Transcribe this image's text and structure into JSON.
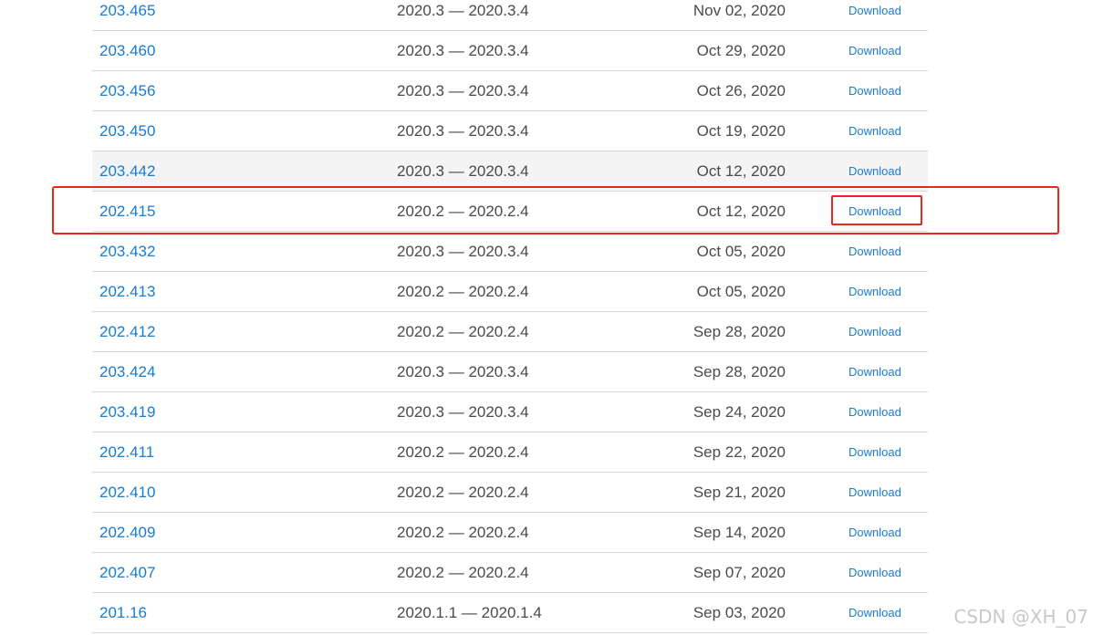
{
  "rows": [
    {
      "build": "203.465",
      "compat": "2020.3 — 2020.3.4",
      "date": "Nov 02, 2020",
      "action": "Download"
    },
    {
      "build": "203.460",
      "compat": "2020.3 — 2020.3.4",
      "date": "Oct 29, 2020",
      "action": "Download"
    },
    {
      "build": "203.456",
      "compat": "2020.3 — 2020.3.4",
      "date": "Oct 26, 2020",
      "action": "Download"
    },
    {
      "build": "203.450",
      "compat": "2020.3 — 2020.3.4",
      "date": "Oct 19, 2020",
      "action": "Download"
    },
    {
      "build": "203.442",
      "compat": "2020.3 — 2020.3.4",
      "date": "Oct 12, 2020",
      "action": "Download"
    },
    {
      "build": "202.415",
      "compat": "2020.2 — 2020.2.4",
      "date": "Oct 12, 2020",
      "action": "Download"
    },
    {
      "build": "203.432",
      "compat": "2020.3 — 2020.3.4",
      "date": "Oct 05, 2020",
      "action": "Download"
    },
    {
      "build": "202.413",
      "compat": "2020.2 — 2020.2.4",
      "date": "Oct 05, 2020",
      "action": "Download"
    },
    {
      "build": "202.412",
      "compat": "2020.2 — 2020.2.4",
      "date": "Sep 28, 2020",
      "action": "Download"
    },
    {
      "build": "203.424",
      "compat": "2020.3 — 2020.3.4",
      "date": "Sep 28, 2020",
      "action": "Download"
    },
    {
      "build": "203.419",
      "compat": "2020.3 — 2020.3.4",
      "date": "Sep 24, 2020",
      "action": "Download"
    },
    {
      "build": "202.411",
      "compat": "2020.2 — 2020.2.4",
      "date": "Sep 22, 2020",
      "action": "Download"
    },
    {
      "build": "202.410",
      "compat": "2020.2 — 2020.2.4",
      "date": "Sep 21, 2020",
      "action": "Download"
    },
    {
      "build": "202.409",
      "compat": "2020.2 — 2020.2.4",
      "date": "Sep 14, 2020",
      "action": "Download"
    },
    {
      "build": "202.407",
      "compat": "2020.2 — 2020.2.4",
      "date": "Sep 07, 2020",
      "action": "Download"
    },
    {
      "build": "201.16",
      "compat": "2020.1.1 — 2020.1.4",
      "date": "Sep 03, 2020",
      "action": "Download"
    }
  ],
  "watermark": "CSDN @XH_07",
  "colors": {
    "link": "#167dd3",
    "text": "#4a4a4a",
    "annotation": "#e8281c",
    "hover_row": "#f4f4f4"
  }
}
